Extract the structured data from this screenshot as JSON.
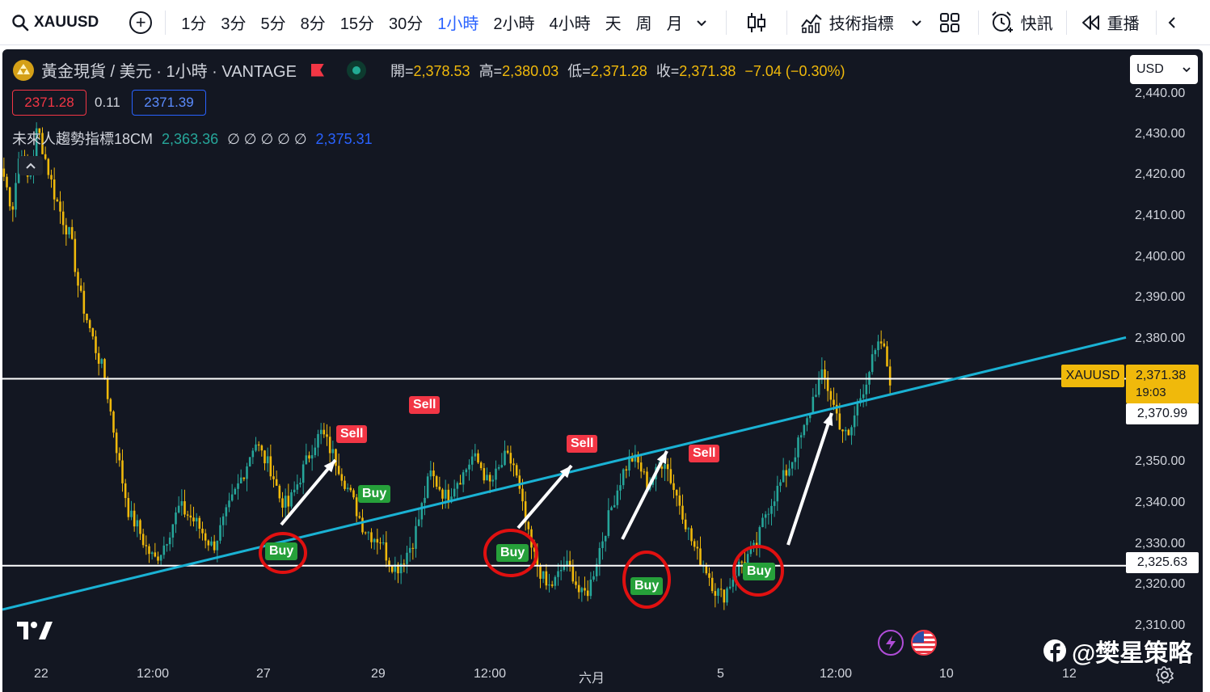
{
  "toolbar": {
    "symbol": "XAUUSD",
    "timeframes": [
      {
        "label": "1分",
        "active": false
      },
      {
        "label": "3分",
        "active": false
      },
      {
        "label": "5分",
        "active": false
      },
      {
        "label": "8分",
        "active": false
      },
      {
        "label": "15分",
        "active": false
      },
      {
        "label": "30分",
        "active": false
      },
      {
        "label": "1小時",
        "active": true
      },
      {
        "label": "2小時",
        "active": false
      },
      {
        "label": "4小時",
        "active": false
      },
      {
        "label": "天",
        "active": false
      },
      {
        "label": "周",
        "active": false
      },
      {
        "label": "月",
        "active": false
      }
    ],
    "indicators_label": "技術指標",
    "alerts_label": "快訊",
    "replay_label": "重播"
  },
  "legend": {
    "title": "黃金現貨 / 美元 · 1小時 · VANTAGE",
    "open_label": "開=",
    "open": "2,378.53",
    "high_label": "高=",
    "high": "2,380.03",
    "low_label": "低=",
    "low": "2,371.28",
    "close_label": "收=",
    "close": "2,371.38",
    "change": "−7.04 (−0.30%)",
    "bid": "2371.28",
    "spread": "0.11",
    "ask": "2371.39",
    "indicator_name": "未來人趨勢指標18CM",
    "indicator_v1": "2,363.36",
    "indicator_empty": "∅ ∅ ∅ ∅ ∅",
    "indicator_v2": "2,375.31"
  },
  "currency": "USD",
  "price_axis": [
    "2,440.00",
    "2,430.00",
    "2,420.00",
    "2,410.00",
    "2,400.00",
    "2,390.00",
    "2,380.00",
    "2,350.00",
    "2,340.00",
    "2,330.00",
    "2,320.00",
    "2,310.00"
  ],
  "time_axis": [
    "22",
    "12:00",
    "27",
    "29",
    "12:00",
    "六月",
    "5",
    "12:00",
    "10",
    "12"
  ],
  "price_markers": {
    "symbol_tag": "XAUUSD",
    "last_price": "2,371.38",
    "countdown": "19:03",
    "level_upper": "2,370.99",
    "level_lower": "2,325.63"
  },
  "signals": [
    {
      "type": "Sell",
      "label": "Sell"
    },
    {
      "type": "Sell",
      "label": "Sell"
    },
    {
      "type": "Sell",
      "label": "Sell"
    },
    {
      "type": "Sell",
      "label": "Sell"
    },
    {
      "type": "Buy",
      "label": "Buy"
    },
    {
      "type": "Buy",
      "label": "Buy"
    },
    {
      "type": "Buy",
      "label": "Buy"
    },
    {
      "type": "Buy",
      "label": "Buy"
    },
    {
      "type": "Buy",
      "label": "Buy"
    }
  ],
  "watermark": "@樊星策略",
  "colors": {
    "background": "#131722",
    "candle_up": "#26a69a",
    "candle_down": "#f0b90b",
    "trendline": "#1ab2d4",
    "level_line": "#ffffff",
    "circle": "#e01010",
    "buy": "#26a03a",
    "sell": "#f23645",
    "accent": "#2962ff"
  },
  "chart_data": {
    "type": "candlestick",
    "symbol": "XAUUSD",
    "ylim": [
      2305,
      2445
    ],
    "horizontal_levels": [
      2370.99,
      2325.63
    ],
    "trendline": {
      "start": 2315,
      "end": 2381
    },
    "ohlc_last": {
      "open": 2378.53,
      "high": 2380.03,
      "low": 2371.28,
      "close": 2371.38
    },
    "path": [
      2420,
      2412,
      2428,
      2418,
      2432,
      2424,
      2416,
      2410,
      2405,
      2392,
      2385,
      2378,
      2372,
      2360,
      2348,
      2338,
      2335,
      2330,
      2327,
      2330,
      2335,
      2340,
      2338,
      2336,
      2333,
      2330,
      2335,
      2340,
      2345,
      2350,
      2356,
      2352,
      2349,
      2342,
      2340,
      2345,
      2350,
      2355,
      2358,
      2354,
      2350,
      2345,
      2340,
      2335,
      2333,
      2332,
      2327,
      2325,
      2328,
      2332,
      2340,
      2348,
      2345,
      2342,
      2346,
      2348,
      2352,
      2350,
      2345,
      2348,
      2352,
      2350,
      2340,
      2330,
      2325,
      2320,
      2322,
      2326,
      2324,
      2318,
      2320,
      2328,
      2335,
      2342,
      2348,
      2352,
      2350,
      2345,
      2348,
      2352,
      2345,
      2340,
      2333,
      2328,
      2325,
      2320,
      2318,
      2322,
      2326,
      2328,
      2330,
      2338,
      2342,
      2346,
      2350,
      2355,
      2360,
      2368,
      2372,
      2366,
      2360,
      2356,
      2364,
      2370,
      2376,
      2380,
      2371
    ]
  }
}
